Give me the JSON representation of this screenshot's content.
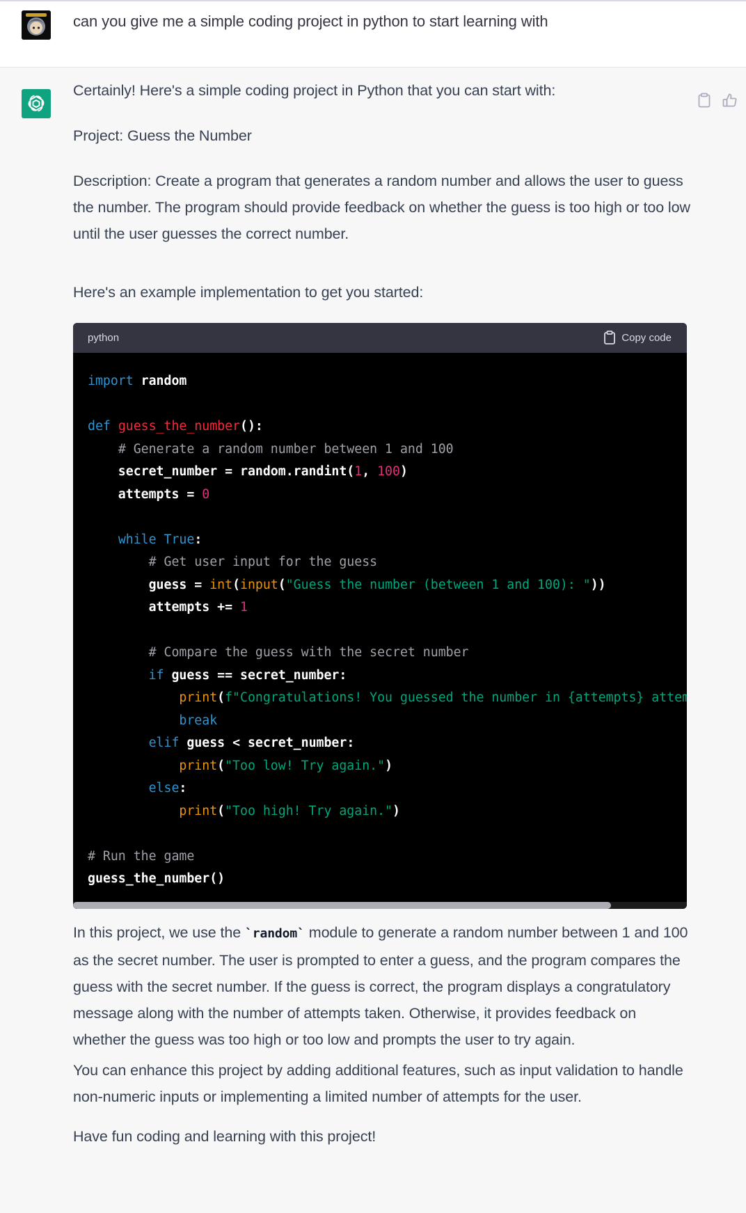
{
  "user": {
    "message": "can you give me a simple coding project in python to start learning with"
  },
  "assistant": {
    "intro": "Certainly! Here's a simple coding project in Python that you can start with:",
    "project": "Project: Guess the Number",
    "description": "Description: Create a program that generates a random number and allows the user to guess the number. The program should provide feedback on whether the guess is too high or too low until the user guesses the correct number.",
    "lead_in": "Here's an example implementation to get you started:",
    "code_block": {
      "language": "python",
      "copy_label": "Copy code",
      "lines": [
        [
          [
            "kw",
            "import"
          ],
          [
            "pl",
            " random"
          ]
        ],
        [],
        [
          [
            "kw",
            "def"
          ],
          [
            "pl",
            " "
          ],
          [
            "fn",
            "guess_the_number"
          ],
          [
            "pl",
            "():"
          ]
        ],
        [
          [
            "pl",
            "    "
          ],
          [
            "cm",
            "# Generate a random number between 1 and 100"
          ]
        ],
        [
          [
            "pl",
            "    secret_number = random.randint("
          ],
          [
            "num",
            "1"
          ],
          [
            "pl",
            ", "
          ],
          [
            "num",
            "100"
          ],
          [
            "pl",
            ")"
          ]
        ],
        [
          [
            "pl",
            "    attempts = "
          ],
          [
            "num",
            "0"
          ]
        ],
        [],
        [
          [
            "pl",
            "    "
          ],
          [
            "kw",
            "while"
          ],
          [
            "pl",
            " "
          ],
          [
            "kw",
            "True"
          ],
          [
            "pl",
            ":"
          ]
        ],
        [
          [
            "pl",
            "        "
          ],
          [
            "cm",
            "# Get user input for the guess"
          ]
        ],
        [
          [
            "pl",
            "        guess = "
          ],
          [
            "bi",
            "int"
          ],
          [
            "pl",
            "("
          ],
          [
            "bi",
            "input"
          ],
          [
            "pl",
            "("
          ],
          [
            "str",
            "\"Guess the number (between 1 and 100): \""
          ],
          [
            "pl",
            "))"
          ]
        ],
        [
          [
            "pl",
            "        attempts += "
          ],
          [
            "num",
            "1"
          ]
        ],
        [],
        [
          [
            "pl",
            "        "
          ],
          [
            "cm",
            "# Compare the guess with the secret number"
          ]
        ],
        [
          [
            "pl",
            "        "
          ],
          [
            "kw",
            "if"
          ],
          [
            "pl",
            " guess == secret_number:"
          ]
        ],
        [
          [
            "pl",
            "            "
          ],
          [
            "bi",
            "print"
          ],
          [
            "pl",
            "("
          ],
          [
            "str",
            "f\"Congratulations! You guessed the number in {attempts} attempts!\""
          ],
          [
            "pl",
            ")"
          ]
        ],
        [
          [
            "pl",
            "            "
          ],
          [
            "kw",
            "break"
          ]
        ],
        [
          [
            "pl",
            "        "
          ],
          [
            "kw",
            "elif"
          ],
          [
            "pl",
            " guess < secret_number:"
          ]
        ],
        [
          [
            "pl",
            "            "
          ],
          [
            "bi",
            "print"
          ],
          [
            "pl",
            "("
          ],
          [
            "str",
            "\"Too low! Try again.\""
          ],
          [
            "pl",
            ")"
          ]
        ],
        [
          [
            "pl",
            "        "
          ],
          [
            "kw",
            "else"
          ],
          [
            "pl",
            ":"
          ]
        ],
        [
          [
            "pl",
            "            "
          ],
          [
            "bi",
            "print"
          ],
          [
            "pl",
            "("
          ],
          [
            "str",
            "\"Too high! Try again.\""
          ],
          [
            "pl",
            ")"
          ]
        ],
        [],
        [
          [
            "cm",
            "# Run the game"
          ]
        ],
        [
          [
            "pl",
            "guess_the_number()"
          ]
        ]
      ]
    },
    "explanation_before_code": "In this project, we use the ",
    "explanation_code": "`random`",
    "explanation_after_code": " module to generate a random number between 1 and 100 as the secret number. The user is prompted to enter a guess, and the program compares the guess with the secret number. If the guess is correct, the program displays a congratulatory message along with the number of attempts taken. Otherwise, it provides feedback on whether the guess was too high or too low and prompts the user to try again.",
    "enhance": "You can enhance this project by adding additional features, such as input validation to handle non-numeric inputs or implementing a limited number of attempts for the user.",
    "closing": "Have fun coding and learning with this project!"
  },
  "icons": {
    "user_avatar": "avatar-image",
    "bot_avatar": "openai-logo-icon",
    "copy": "clipboard-icon",
    "thumbs_up": "thumbs-up-icon"
  },
  "colors": {
    "bot_avatar_bg": "#10a37f",
    "code_bg": "#000000",
    "code_header_bg": "#343541"
  }
}
